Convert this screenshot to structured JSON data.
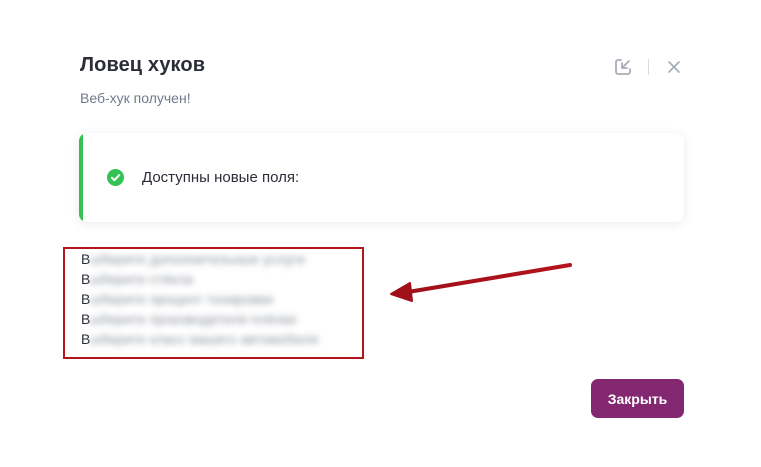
{
  "dialog": {
    "title": "Ловец хуков",
    "subtitle": "Веб-хук получен!"
  },
  "header_actions": {
    "icons": [
      "open-external-icon",
      "close-icon"
    ]
  },
  "notice": {
    "text": "Доступны новые поля:",
    "icon": "check-circle-icon",
    "accent_color": "#36c155"
  },
  "fields": {
    "items": [
      {
        "first": "В",
        "rest": "ыберите дополнительные услуги"
      },
      {
        "first": "В",
        "rest": "ыберите стёкла"
      },
      {
        "first": "В",
        "rest": "ыберите процент тонировки"
      },
      {
        "first": "В",
        "rest": "ыберите производителя плёнки"
      },
      {
        "first": "В",
        "rest": "ыберите класс вашего автомобиля"
      }
    ],
    "highlight_color": "#b3151c"
  },
  "footer": {
    "close_label": "Закрыть",
    "button_color": "#832770"
  }
}
